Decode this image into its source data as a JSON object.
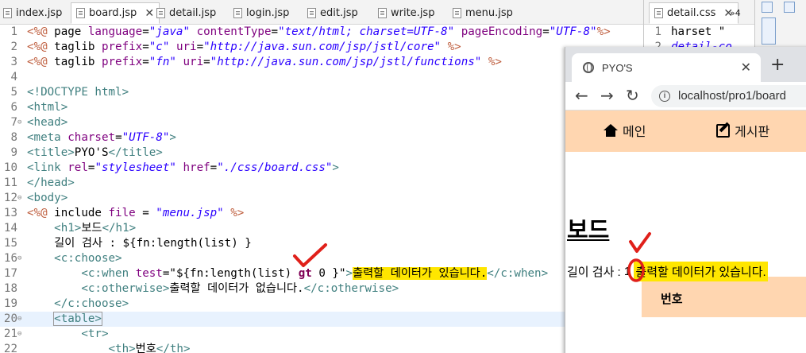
{
  "editor": {
    "tabs": [
      {
        "label": "index.jsp",
        "active": false
      },
      {
        "label": "board.jsp",
        "active": true
      },
      {
        "label": "detail.jsp",
        "active": false
      },
      {
        "label": "login.jsp",
        "active": false
      },
      {
        "label": "edit.jsp",
        "active": false
      },
      {
        "label": "write.jsp",
        "active": false
      },
      {
        "label": "menu.jsp",
        "active": false
      }
    ],
    "close_glyph": "✕",
    "side_tab": "detail.css",
    "overflow_label": "»4",
    "side_lines": [
      {
        "num": "1",
        "text": "harset \""
      },
      {
        "num": "2",
        "text": "detail-co"
      }
    ]
  },
  "browser": {
    "tab_title": "PYO'S",
    "url": "localhost/pro1/board",
    "menu": [
      {
        "label": "메인",
        "icon": "home-icon"
      },
      {
        "label": "게시판",
        "icon": "edit-icon"
      }
    ],
    "heading": "보드",
    "length_label": "길이 검사 :",
    "length_value": "1",
    "message": "출력할 데이터가 있습니다.",
    "th_label": "번호"
  },
  "colors": {
    "highlight": "#ffe600",
    "menu_bg": "#ffd6b0",
    "annotation": "#e0201a"
  }
}
